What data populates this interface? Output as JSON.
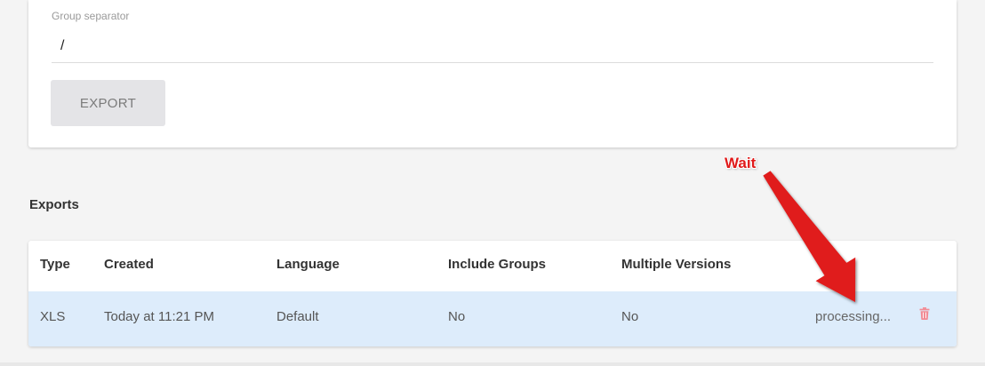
{
  "form": {
    "group_separator_label": "Group separator",
    "group_separator_value": "/",
    "export_button_label": "EXPORT"
  },
  "exports": {
    "section_title": "Exports",
    "columns": [
      "Type",
      "Created",
      "Language",
      "Include Groups",
      "Multiple Versions"
    ],
    "rows": [
      {
        "type": "XLS",
        "created": "Today at 11:21 PM",
        "language": "Default",
        "include_groups": "No",
        "multiple_versions": "No",
        "status": "processing..."
      }
    ]
  },
  "annotation": {
    "label": "Wait",
    "color": "#e01a1a"
  },
  "colors": {
    "row_highlight": "#ddecfb",
    "trash_icon": "#f28b95",
    "button_bg": "#e4e4e7"
  },
  "icons": {
    "delete": "trash-icon"
  }
}
